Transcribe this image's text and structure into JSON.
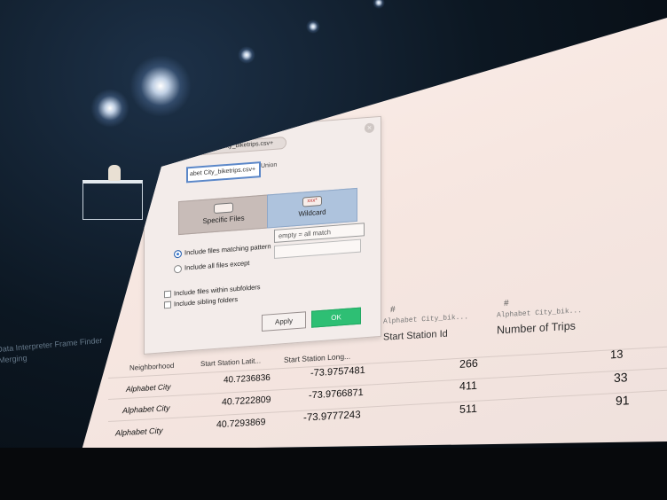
{
  "dialog": {
    "connection_pill": "Alphabet City_biketrips.csv+",
    "union_field": "abet City_biketrips.csv+",
    "union_label": "Union",
    "tabs": {
      "specific_files": "Specific Files",
      "wildcard": "Wildcard",
      "wildcard_icon_text": "xxx*"
    },
    "radio_include_matching": "Include files matching pattern",
    "radio_include_except": "Include all files except",
    "pattern_placeholder": "empty = all match",
    "check_subfolders": "Include files within subfolders",
    "check_sibling": "Include sibling folders",
    "apply_label": "Apply",
    "ok_label": "OK",
    "accent_ok": "#2ebf74",
    "accent_selected": "#aec3dd"
  },
  "side_text": {
    "line1": "Data Interpreter  Frame Finder",
    "line2": "Merging"
  },
  "table": {
    "columns": [
      {
        "name": "Neighborhood"
      },
      {
        "name": "Start Station Latit..."
      },
      {
        "name": "Start Station Long..."
      },
      {
        "source": "Alphabet City_bik...",
        "name": "Start Station Id",
        "type_icon": "#"
      },
      {
        "source": "Alphabet City_bik...",
        "name": "Number of Trips",
        "type_icon": "#"
      }
    ],
    "rows": [
      [
        "Alphabet City",
        "40.7236836",
        "-73.9757481",
        "266",
        "13"
      ],
      [
        "Alphabet City",
        "40.7222809",
        "-73.9766871",
        "411",
        "33"
      ],
      [
        "Alphabet City",
        "40.7293869",
        "-73.9777243",
        "511",
        "91"
      ]
    ]
  }
}
